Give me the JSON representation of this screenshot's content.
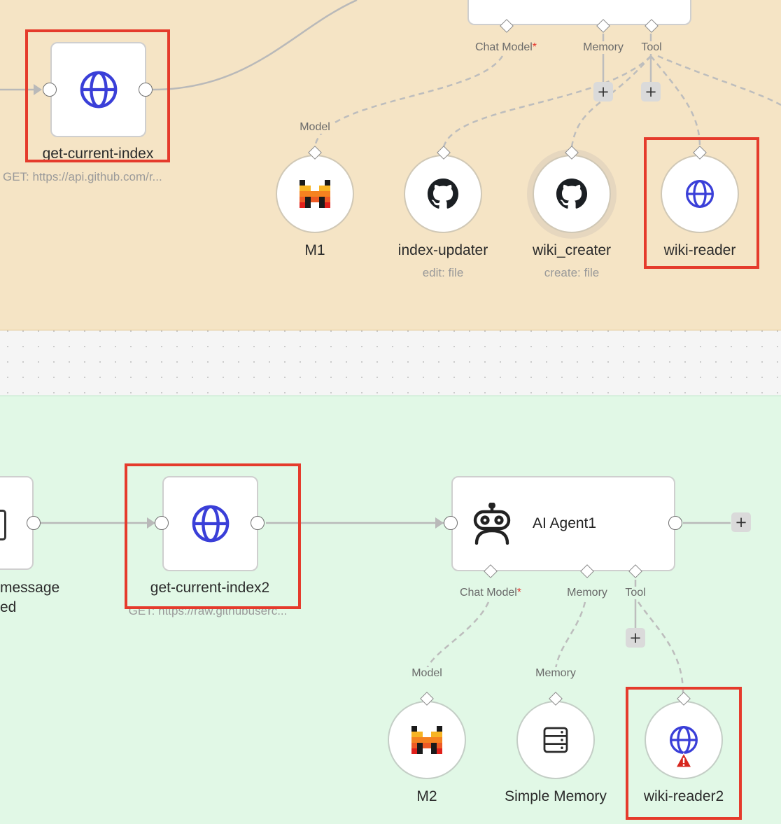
{
  "top_group": {
    "get_current_index": {
      "title": "get-current-index",
      "subtitle": "GET: https://api.github.com/r..."
    },
    "agent_ports": {
      "chat_model": "Chat Model",
      "chat_model_required": "*",
      "memory": "Memory",
      "tool": "Tool"
    },
    "model_port_label": "Model",
    "sub_nodes": [
      {
        "title": "M1",
        "subtitle": "",
        "icon": "mistral-icon"
      },
      {
        "title": "index-updater",
        "subtitle": "edit: file",
        "icon": "github-icon"
      },
      {
        "title": "wiki_creater",
        "subtitle": "create: file",
        "icon": "github-icon"
      },
      {
        "title": "wiki-reader",
        "subtitle": "",
        "icon": "globe-icon"
      }
    ]
  },
  "bottom_group": {
    "message_node": {
      "title_line1": "message",
      "title_line2": "ed"
    },
    "get_current_index2": {
      "title": "get-current-index2",
      "subtitle": "GET: https://raw.githubuserc..."
    },
    "agent": {
      "title": "AI Agent1",
      "ports": {
        "chat_model": "Chat Model",
        "chat_model_required": "*",
        "memory": "Memory",
        "tool": "Tool"
      }
    },
    "sub_port_labels": {
      "model": "Model",
      "memory": "Memory"
    },
    "sub_nodes": [
      {
        "title": "M2",
        "icon": "mistral-icon"
      },
      {
        "title": "Simple Memory",
        "icon": "database-icon"
      },
      {
        "title": "wiki-reader2",
        "icon": "globe-warning-icon"
      }
    ]
  },
  "buttons": {
    "plus": "+"
  },
  "colors": {
    "top_group_bg": "#f5e4c5",
    "bottom_group_bg": "#e1f8e6",
    "globe_icon": "#3a3fd8",
    "highlight": "#e53b2c",
    "required": "#e5342b"
  }
}
